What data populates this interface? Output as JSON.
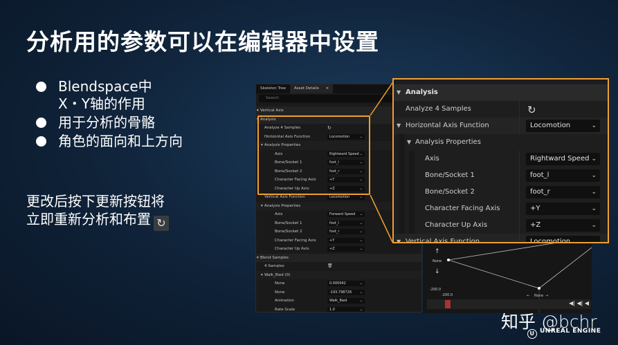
{
  "slide": {
    "title": "分析用的参数可以在编辑器中设置",
    "bullets": [
      "Blendspace中\nX・Y轴的作用",
      "用于分析的骨骼",
      "角色的面向和上方向"
    ],
    "note_line1": "更改后按下更新按钮将",
    "note_line2": "立即重新分析和布置"
  },
  "editor": {
    "tabs": [
      "Skeleton Tree",
      "Asset Details"
    ],
    "tab_close": "×",
    "search_placeholder": "Search",
    "rows": [
      {
        "label": "Vertical Axis",
        "value": "",
        "kind": "hdr"
      },
      {
        "label": "Analysis",
        "value": "",
        "kind": "hdr"
      },
      {
        "label": "Analyze 4 Samples",
        "value": "",
        "kind": "prop"
      },
      {
        "label": "Horizontal Axis Function",
        "value": "Locomotion",
        "kind": "prop"
      },
      {
        "label": "Analysis Properties",
        "value": "",
        "kind": "sub"
      },
      {
        "label": "Axis",
        "value": "Rightward Speed",
        "kind": "prop2"
      },
      {
        "label": "Bone/Socket 1",
        "value": "foot_l",
        "kind": "prop2"
      },
      {
        "label": "Bone/Socket 2",
        "value": "foot_r",
        "kind": "prop2"
      },
      {
        "label": "Character Facing Axis",
        "value": "+Y",
        "kind": "prop2"
      },
      {
        "label": "Character Up Axis",
        "value": "+Z",
        "kind": "prop2"
      },
      {
        "label": "Vertical Axis Function",
        "value": "Locomotion",
        "kind": "prop"
      },
      {
        "label": "Analysis Properties",
        "value": "",
        "kind": "sub"
      },
      {
        "label": "Axis",
        "value": "Forward Speed",
        "kind": "prop2"
      },
      {
        "label": "Bone/Socket 1",
        "value": "foot_l",
        "kind": "prop2"
      },
      {
        "label": "Bone/Socket 2",
        "value": "foot_r",
        "kind": "prop2"
      },
      {
        "label": "Character Facing Axis",
        "value": "+Y",
        "kind": "prop2"
      },
      {
        "label": "Character Up Axis",
        "value": "+Z",
        "kind": "prop2"
      },
      {
        "label": "Blend Samples",
        "value": "",
        "kind": "hdr"
      },
      {
        "label": "4 Samples",
        "value": "",
        "kind": "prop"
      },
      {
        "label": "Walk_Bwd (0)",
        "value": "",
        "kind": "sub"
      },
      {
        "label": "None",
        "value": "0.000042",
        "kind": "prop2"
      },
      {
        "label": "None",
        "value": "-193.798728",
        "kind": "prop2"
      },
      {
        "label": "Animation",
        "value": "Walk_Bwd",
        "kind": "prop2"
      },
      {
        "label": "Rate Scale",
        "value": "1.0",
        "kind": "prop2"
      }
    ]
  },
  "graph": {
    "y_top_label": "None",
    "y_bottom_value": "-200.0",
    "x_left_value": "-200.0",
    "x_label": "None",
    "timeline_buttons": "◀| ◀| ◀"
  },
  "zoom": {
    "rows": [
      {
        "label": "Analysis",
        "value": "",
        "kind": "hdr"
      },
      {
        "label": "Analyze 4 Samples",
        "value": "",
        "kind": "refresh"
      },
      {
        "label": "Horizontal Axis Function",
        "value": "Locomotion",
        "kind": "sec"
      },
      {
        "label": "Analysis Properties",
        "value": "",
        "kind": "sub"
      },
      {
        "label": "Axis",
        "value": "Rightward Speed",
        "kind": "prop"
      },
      {
        "label": "Bone/Socket 1",
        "value": "foot_l",
        "kind": "prop"
      },
      {
        "label": "Bone/Socket 2",
        "value": "foot_r",
        "kind": "prop"
      },
      {
        "label": "Character Facing Axis",
        "value": "+Y",
        "kind": "prop"
      },
      {
        "label": "Character Up Axis",
        "value": "+Z",
        "kind": "prop"
      },
      {
        "label": "Vertical Axis Function",
        "value": "Locomotion",
        "kind": "sec"
      }
    ]
  },
  "watermark": "知乎 @bchr",
  "logo_text": "UNREAL ENGINE",
  "colors": {
    "highlight": "#f0a030",
    "background": "#0f2238"
  }
}
